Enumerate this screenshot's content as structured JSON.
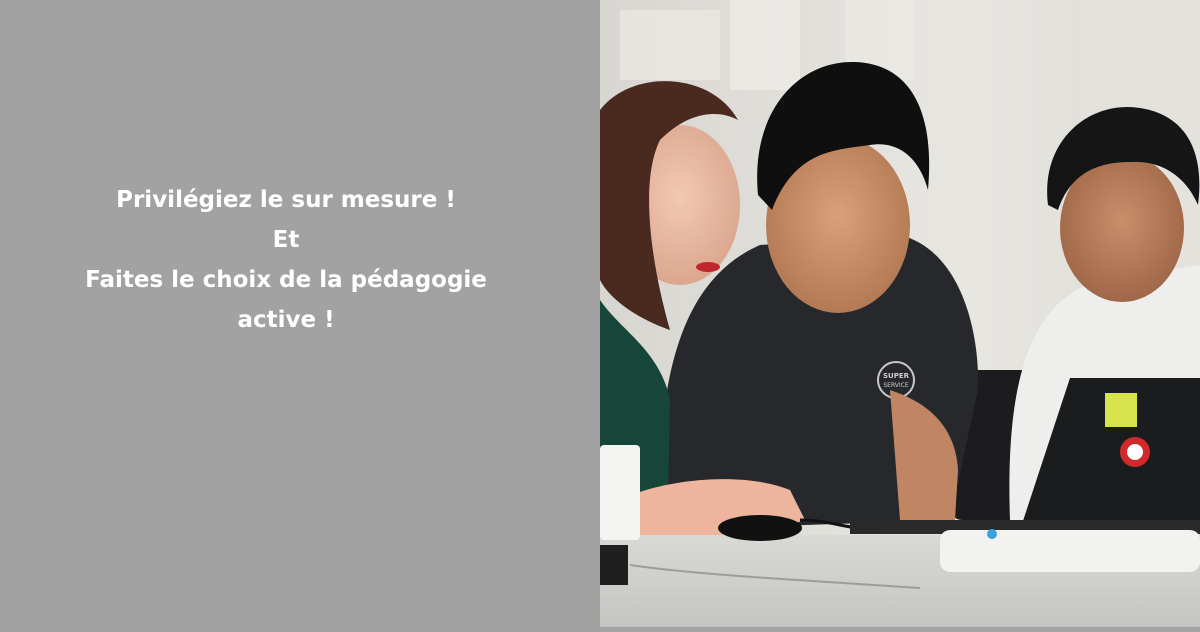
{
  "headline": {
    "lines": [
      "Privilégiez le sur mesure !",
      "Et",
      "Faites le choix de la pédagogie",
      "active !"
    ]
  },
  "photo": {
    "tshirt_logo": [
      "SUPER",
      "SERVICE"
    ]
  },
  "colors": {
    "panel_bg": "#a2a2a2",
    "headline_text": "#ffffff"
  }
}
